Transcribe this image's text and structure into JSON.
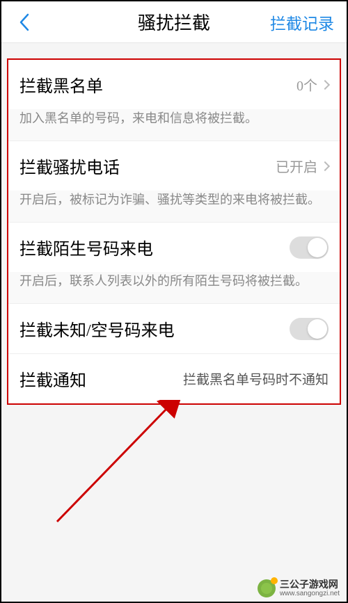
{
  "header": {
    "title": "骚扰拦截",
    "right": "拦截记录"
  },
  "items": {
    "blacklist": {
      "label": "拦截黑名单",
      "value": "0个",
      "desc": "加入黑名单的号码，来电和信息将被拦截。"
    },
    "harass": {
      "label": "拦截骚扰电话",
      "value": "已开启",
      "desc": "开启后，被标记为诈骗、骚扰等类型的来电将被拦截。"
    },
    "stranger": {
      "label": "拦截陌生号码来电",
      "desc": "开启后，联系人列表以外的所有陌生号码将被拦截。"
    },
    "unknown": {
      "label": "拦截未知/空号码来电"
    },
    "notify": {
      "label": "拦截通知",
      "value": "拦截黑名单号码时不通知"
    }
  },
  "watermark": {
    "name": "三公子游戏网",
    "url": "www.sangongzi.net"
  }
}
